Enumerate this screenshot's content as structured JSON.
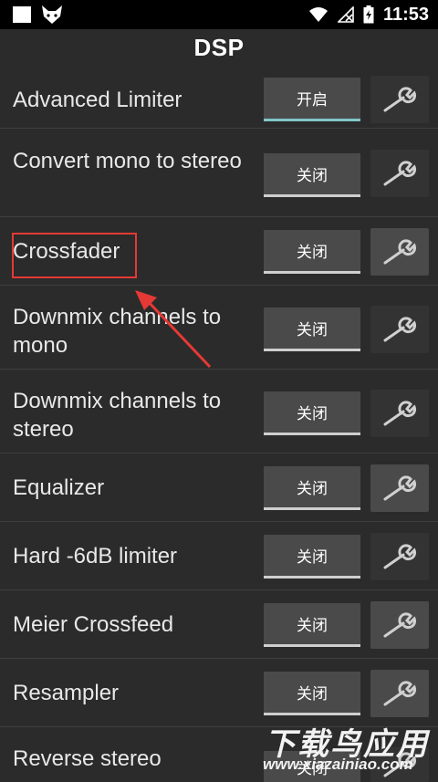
{
  "status_bar": {
    "time": "11:53"
  },
  "header": {
    "title": "DSP"
  },
  "rows": [
    {
      "label": "Advanced Limiter",
      "toggle": "开启"
    },
    {
      "label": "Convert mono to stereo",
      "toggle": "关闭"
    },
    {
      "label": "Crossfader",
      "toggle": "关闭"
    },
    {
      "label": "Downmix channels to mono",
      "toggle": "关闭"
    },
    {
      "label": "Downmix channels to stereo",
      "toggle": "关闭"
    },
    {
      "label": "Equalizer",
      "toggle": "关闭"
    },
    {
      "label": "Hard -6dB limiter",
      "toggle": "关闭"
    },
    {
      "label": "Meier Crossfeed",
      "toggle": "关闭"
    },
    {
      "label": "Resampler",
      "toggle": "关闭"
    },
    {
      "label": "Reverse stereo",
      "toggle": "关闭"
    }
  ],
  "watermark": {
    "title": "下载鸟应用",
    "url": "www.xiazainiao.com"
  },
  "colors": {
    "toggle_on_accent": "#7fc6c9",
    "annotation": "#e53935"
  }
}
